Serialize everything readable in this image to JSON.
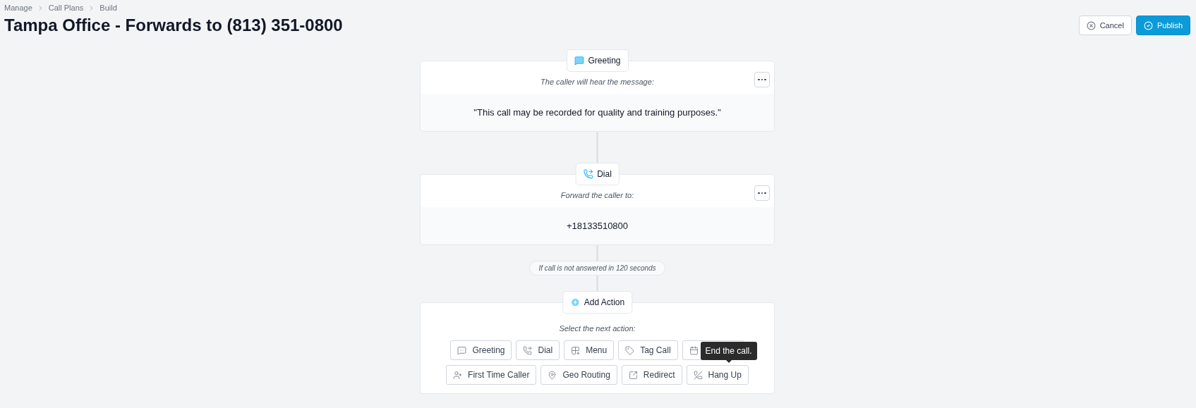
{
  "breadcrumbs": [
    "Manage",
    "Call Plans",
    "Build"
  ],
  "title": "Tampa Office - Forwards to (813) 351-0800",
  "header_buttons": [
    {
      "label": "Cancel",
      "kind": "cancel"
    },
    {
      "label": "Publish",
      "kind": "publish"
    }
  ],
  "steps": [
    {
      "kind": "greeting",
      "name": "Greeting",
      "caption": "The caller will hear the message:",
      "value": "\"This call may be recorded for quality and training purposes.\""
    },
    {
      "kind": "dial",
      "name": "Dial",
      "caption": "Forward the caller to:",
      "value": "+18133510800"
    }
  ],
  "condition": "If call is not answered in 120 seconds",
  "add_action": {
    "name": "Add Action",
    "caption": "Select the next action:",
    "actions": [
      {
        "kind": "greeting",
        "label": "Greeting"
      },
      {
        "kind": "dial",
        "label": "Dial"
      },
      {
        "kind": "menu",
        "label": "Menu"
      },
      {
        "kind": "tag",
        "label": "Tag Call"
      },
      {
        "kind": "calendar"
      },
      {
        "kind": "person",
        "label": "First Time Caller"
      },
      {
        "kind": "pin",
        "label": "Geo Routing"
      },
      {
        "kind": "redirect",
        "label": "Redirect"
      },
      {
        "kind": "hangup",
        "label": "Hang Up"
      }
    ],
    "tooltip": "End the call."
  }
}
